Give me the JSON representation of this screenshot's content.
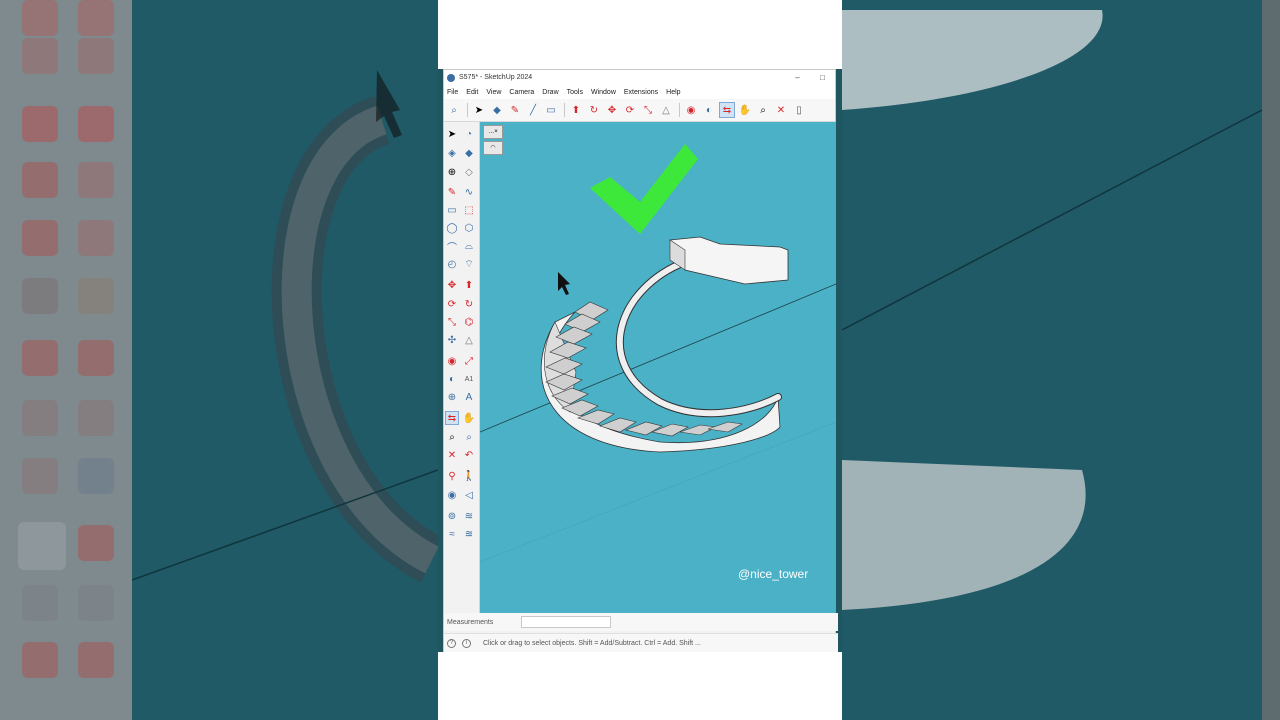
{
  "window": {
    "title": "S575* - SketchUp 2024",
    "minimize": "–",
    "maximize": "□"
  },
  "menu": [
    "File",
    "Edit",
    "View",
    "Camera",
    "Draw",
    "Tools",
    "Window",
    "Extensions",
    "Help"
  ],
  "toolbar_icons": [
    "search-icon",
    "select-icon",
    "eraser-icon",
    "pencil-icon",
    "line-icon",
    "rectangle-icon",
    "push-pull-icon",
    "follow-me-icon",
    "move-icon",
    "rotate-icon",
    "scale-icon",
    "offset-icon",
    "tape-icon",
    "protractor-icon",
    "orbit-icon",
    "pan-icon",
    "zoom-icon",
    "zoom-extents-icon",
    "page-icon"
  ],
  "measurements": {
    "label": "Measurements",
    "value": ""
  },
  "status": {
    "hint": "Click or drag to select objects. Shift = Add/Subtract. Ctrl = Add. Shift ..."
  },
  "viewport": {
    "watermark": "@nice_tower",
    "background_color": "#4bb1c6",
    "check_color": "#3ee83a"
  },
  "colors": {
    "accent": "#d9262b",
    "selection": "#cfe3f5"
  }
}
